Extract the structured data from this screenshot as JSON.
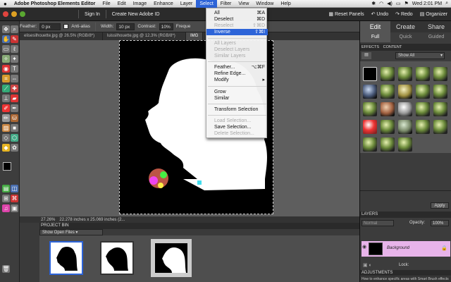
{
  "menubar": {
    "apple": "",
    "items": [
      "Adobe Photoshop Elements Editor",
      "File",
      "Edit",
      "Image",
      "Enhance",
      "Layer",
      "Select",
      "Filter",
      "View",
      "Window",
      "Help"
    ],
    "active_index": 6,
    "clock": "Wed 2:01 PM"
  },
  "appbar": {
    "sign_in": "Sign In",
    "create_id": "Create New Adobe ID",
    "reset_panels": "Reset Panels",
    "undo": "Undo",
    "redo": "Redo",
    "organizer": "Organizer"
  },
  "options": {
    "feather_label": "Feather:",
    "feather_value": "0 px",
    "antialias_label": "Anti-alias",
    "width_label": "Width:",
    "width_value": "10 px",
    "contrast_label": "Contrast:",
    "contrast_value": "10%",
    "frequency_label": "Freque"
  },
  "tabs": [
    {
      "label": "elisesilhouette.jpg @ 26.5% (RGB/8*)"
    },
    {
      "label": "luissilhouette.jpg @ 12.3% (RGB/8*)"
    },
    {
      "label": "IMG"
    }
  ],
  "select_menu": {
    "items": [
      {
        "label": "All",
        "shortcut": "⌘A",
        "disabled": false
      },
      {
        "label": "Deselect",
        "shortcut": "⌘D",
        "disabled": false
      },
      {
        "label": "Reselect",
        "shortcut": "⇧⌘D",
        "disabled": true
      },
      {
        "label": "Inverse",
        "shortcut": "⇧⌘I",
        "disabled": false
      },
      {
        "label": "All Layers",
        "shortcut": "",
        "disabled": true
      },
      {
        "label": "Deselect Layers",
        "shortcut": "",
        "disabled": true
      },
      {
        "label": "Similar Layers",
        "shortcut": "",
        "disabled": true
      },
      {
        "label": "Feather...",
        "shortcut": "⌥⌘F",
        "disabled": false
      },
      {
        "label": "Refine Edge...",
        "shortcut": "",
        "disabled": false
      },
      {
        "label": "Modify",
        "shortcut": "▸",
        "disabled": false
      },
      {
        "label": "Grow",
        "shortcut": "",
        "disabled": false
      },
      {
        "label": "Similar",
        "shortcut": "",
        "disabled": false
      },
      {
        "label": "Transform Selection",
        "shortcut": "",
        "disabled": false
      },
      {
        "label": "Load Selection...",
        "shortcut": "",
        "disabled": true
      },
      {
        "label": "Save Selection...",
        "shortcut": "",
        "disabled": false
      },
      {
        "label": "Delete Selection...",
        "shortcut": "",
        "disabled": true
      }
    ],
    "highlighted_index": 3
  },
  "status": {
    "zoom": "27.26%",
    "size": "22.278 inches x 25.069 inches (2..."
  },
  "project_bin": {
    "title": "PROJECT BIN",
    "show": "Show Open Files"
  },
  "right_panel": {
    "tabs": [
      "Edit",
      "Create",
      "Share"
    ],
    "subtabs": [
      "Full",
      "Quick",
      "Guided"
    ],
    "effects_label": "EFFECTS",
    "content_label": "CONTENT",
    "show_all": "Show All",
    "apply": "Apply",
    "layers_title": "LAYERS",
    "normal": "Normal",
    "opacity_label": "Opacity:",
    "opacity_value": "100%",
    "layer_name": "Background",
    "lock_label": "Lock:",
    "adjustments": "ADJUSTMENTS",
    "tip": "How to enhance specific areas with Smart Brush effects"
  },
  "colors": {
    "accent": "#2d64d8",
    "layer_highlight": "#e8b4ea"
  }
}
